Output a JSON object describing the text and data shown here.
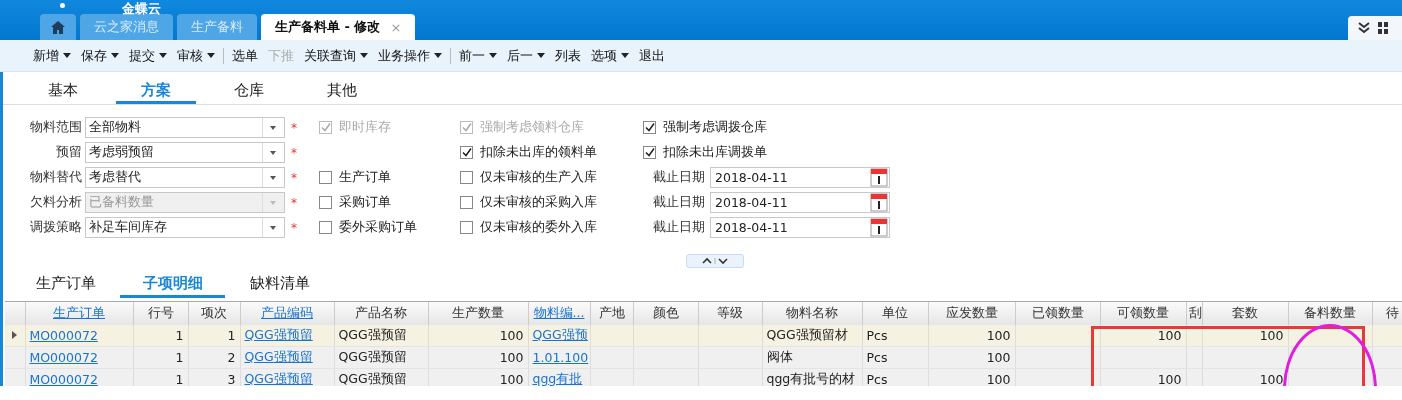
{
  "app": {
    "logo_text": "金蝶云"
  },
  "doc_tabs": [
    {
      "kind": "home",
      "selected": false
    },
    {
      "kind": "text",
      "label": "云之家消息",
      "selected": false
    },
    {
      "kind": "text",
      "label": "生产备料",
      "selected": false
    },
    {
      "kind": "text",
      "label": "生产备料单 - 修改",
      "selected": true,
      "close": "×"
    }
  ],
  "toolbar": [
    {
      "label": "新增",
      "dropdown": true,
      "disabled": false
    },
    {
      "label": "保存",
      "dropdown": true,
      "disabled": false
    },
    {
      "label": "提交",
      "dropdown": true,
      "disabled": false
    },
    {
      "label": "审核",
      "dropdown": true,
      "disabled": false
    },
    {
      "kind": "separator"
    },
    {
      "label": "选单",
      "dropdown": false,
      "disabled": false
    },
    {
      "label": "下推",
      "dropdown": false,
      "disabled": true
    },
    {
      "label": "关联查询",
      "dropdown": true,
      "disabled": false
    },
    {
      "label": "业务操作",
      "dropdown": true,
      "disabled": false
    },
    {
      "kind": "separator"
    },
    {
      "label": "前一",
      "dropdown": true,
      "disabled": false
    },
    {
      "label": "后一",
      "dropdown": true,
      "disabled": false
    },
    {
      "label": "列表",
      "dropdown": false,
      "disabled": false
    },
    {
      "label": "选项",
      "dropdown": true,
      "disabled": false
    },
    {
      "label": "退出",
      "dropdown": false,
      "disabled": false
    }
  ],
  "page_tabs": [
    {
      "label": "基本",
      "selected": false
    },
    {
      "label": "方案",
      "selected": true
    },
    {
      "label": "仓库",
      "selected": false
    },
    {
      "label": "其他",
      "selected": false
    }
  ],
  "form": {
    "rows": [
      {
        "label": "物料范围",
        "select": {
          "value": "全部物料",
          "disabled": false,
          "required_mark": "*"
        },
        "options": [
          {
            "kind": "checkbox",
            "label": "即时库存",
            "checked": true,
            "disabled": true
          },
          {
            "kind": "checkbox",
            "label": "强制考虑领料仓库",
            "checked": true,
            "disabled": true
          },
          {
            "kind": "checkbox",
            "label": "强制考虑调拨仓库",
            "checked": true,
            "disabled": false
          }
        ]
      },
      {
        "label": "预留",
        "select": {
          "value": "考虑弱预留",
          "disabled": false,
          "required_mark": "*"
        },
        "options": [
          {
            "kind": "blank"
          },
          {
            "kind": "checkbox",
            "label": "扣除未出库的领料单",
            "checked": true,
            "disabled": false
          },
          {
            "kind": "checkbox",
            "label": "扣除未出库调拨单",
            "checked": true,
            "disabled": false
          }
        ]
      },
      {
        "label": "物料替代",
        "select": {
          "value": "考虑替代",
          "disabled": false,
          "required_mark": "*"
        },
        "options": [
          {
            "kind": "checkbox",
            "label": "生产订单",
            "checked": false,
            "disabled": false
          },
          {
            "kind": "checkbox",
            "label": "仅未审核的生产入库",
            "checked": false,
            "disabled": false
          },
          {
            "kind": "date",
            "label": "截止日期",
            "value": "2018-04-11"
          }
        ]
      },
      {
        "label": "欠料分析",
        "select": {
          "value": "已备料数量",
          "disabled": true,
          "required_mark": "*"
        },
        "options": [
          {
            "kind": "checkbox",
            "label": "采购订单",
            "checked": false,
            "disabled": false
          },
          {
            "kind": "checkbox",
            "label": "仅未审核的采购入库",
            "checked": false,
            "disabled": false
          },
          {
            "kind": "date",
            "label": "截止日期",
            "value": "2018-04-11"
          }
        ]
      },
      {
        "label": "调拨策略",
        "select": {
          "value": "补足车间库存",
          "disabled": false,
          "required_mark": "*"
        },
        "options": [
          {
            "kind": "checkbox",
            "label": "委外采购订单",
            "checked": false,
            "disabled": false
          },
          {
            "kind": "checkbox",
            "label": "仅未审核的委外入库",
            "checked": false,
            "disabled": false
          },
          {
            "kind": "date",
            "label": "截止日期",
            "value": "2018-04-11"
          }
        ]
      }
    ]
  },
  "sub_tabs": [
    {
      "label": "生产订单",
      "selected": false
    },
    {
      "label": "子项明细",
      "selected": true
    },
    {
      "label": "缺料清单",
      "selected": false
    }
  ],
  "table": {
    "columns": [
      {
        "label": "生产订单",
        "kind": "link"
      },
      {
        "label": "行号",
        "kind": "number"
      },
      {
        "label": "项次",
        "kind": "number"
      },
      {
        "label": "产品编码",
        "kind": "link"
      },
      {
        "label": "产品名称",
        "kind": "text"
      },
      {
        "label": "生产数量",
        "kind": "number"
      },
      {
        "label": "物料编...",
        "kind": "link"
      },
      {
        "label": "产地",
        "kind": "text"
      },
      {
        "label": "颜色",
        "kind": "text"
      },
      {
        "label": "等级",
        "kind": "text"
      },
      {
        "label": "物料名称",
        "kind": "text"
      },
      {
        "label": "单位",
        "kind": "text"
      },
      {
        "label": "应发数量",
        "kind": "number"
      },
      {
        "label": "已领数量",
        "kind": "number"
      },
      {
        "label": "可领数量",
        "kind": "number"
      },
      {
        "label": "刮",
        "kind": "text"
      },
      {
        "label": "套数",
        "kind": "number"
      },
      {
        "label": "备料数量",
        "kind": "number"
      },
      {
        "label": "待",
        "kind": "text"
      }
    ],
    "rows": [
      {
        "selected": true,
        "cells": [
          "MO000072",
          "1",
          "1",
          "QGG强预留",
          "QGG强预留",
          "100",
          "QGG强预",
          "",
          "",
          "",
          "QGG强预留材",
          "Pcs",
          "100",
          "",
          "100",
          "",
          "100",
          "",
          ""
        ]
      },
      {
        "selected": false,
        "cells": [
          "MO000072",
          "1",
          "2",
          "QGG强预留",
          "QGG强预留",
          "100",
          "1.01.100",
          "",
          "",
          "",
          "阀体",
          "Pcs",
          "100",
          "",
          "",
          "",
          "",
          "",
          ""
        ]
      },
      {
        "selected": false,
        "cells": [
          "MO000072",
          "1",
          "3",
          "QGG强预留",
          "QGG强预留",
          "100",
          "qgg有批",
          "",
          "",
          "",
          "qgg有批号的材",
          "Pcs",
          "100",
          "",
          "100",
          "",
          "100",
          "",
          ""
        ]
      }
    ]
  },
  "annotations": [
    {
      "kind": "frame",
      "color": "#e83a3a"
    },
    {
      "kind": "ring",
      "color": "#e01ee0"
    }
  ]
}
